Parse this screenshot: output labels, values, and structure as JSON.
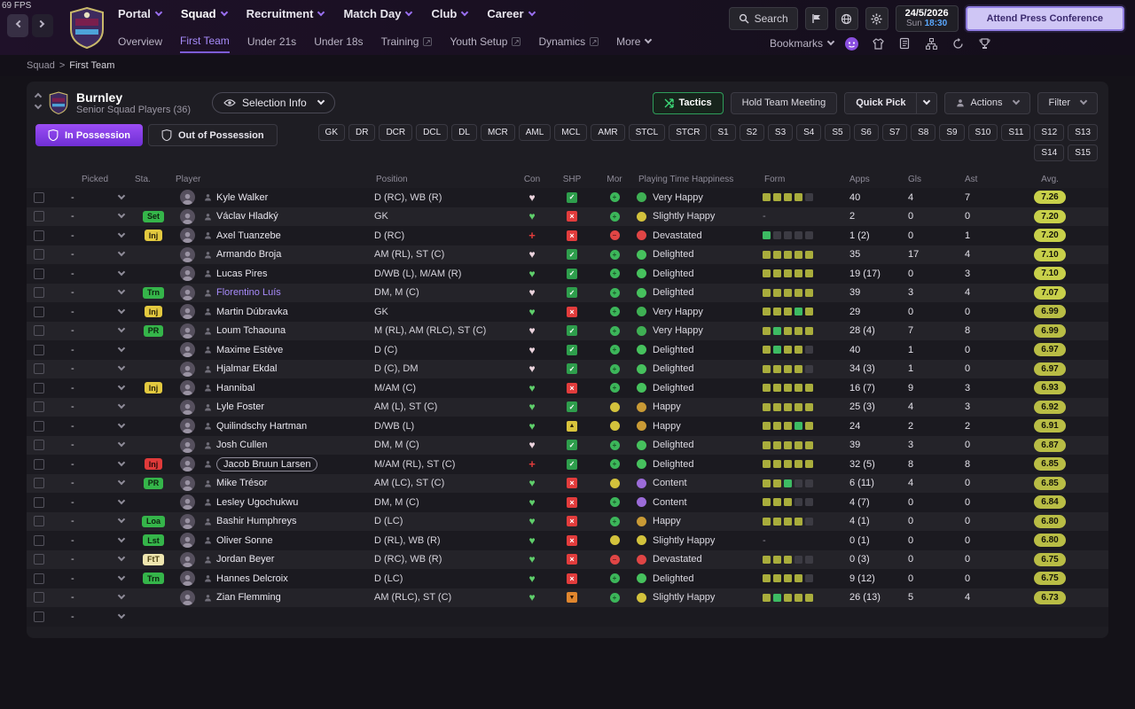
{
  "fps": "69 FPS",
  "search_label": "Search",
  "press_button": "Attend Press Conference",
  "datebox": {
    "date": "24/5/2026",
    "day": "Sun",
    "time": "18:30"
  },
  "topnav": {
    "items": [
      {
        "label": "Portal"
      },
      {
        "label": "Squad",
        "active": true
      },
      {
        "label": "Recruitment"
      },
      {
        "label": "Match Day"
      },
      {
        "label": "Club"
      },
      {
        "label": "Career"
      }
    ]
  },
  "subnav": {
    "bookmarks": "Bookmarks",
    "items": [
      {
        "label": "Overview"
      },
      {
        "label": "First Team",
        "active": true
      },
      {
        "label": "Under 21s"
      },
      {
        "label": "Under 18s"
      },
      {
        "label": "Training",
        "external": true
      },
      {
        "label": "Youth Setup",
        "external": true
      },
      {
        "label": "Dynamics",
        "external": true
      },
      {
        "label": "More",
        "caret": true
      }
    ]
  },
  "breadcrumb": {
    "section": "Squad",
    "sep": ">",
    "page": "First Team"
  },
  "header": {
    "club": "Burnley",
    "subtitle": "Senior Squad Players (36)",
    "selection_info": "Selection Info",
    "tactics": "Tactics",
    "hold_meeting": "Hold Team Meeting",
    "quick_pick": "Quick Pick",
    "actions": "Actions",
    "filter": "Filter"
  },
  "toggles": {
    "in": "In Possession",
    "out": "Out of Possession"
  },
  "chips": [
    "GK",
    "DR",
    "DCR",
    "DCL",
    "DL",
    "MCR",
    "AML",
    "MCL",
    "AMR",
    "STCL",
    "STCR",
    "S1",
    "S2",
    "S3",
    "S4",
    "S5",
    "S6",
    "S7",
    "S8",
    "S9",
    "S10",
    "S11",
    "S12",
    "S13",
    "S14",
    "S15"
  ],
  "columns": [
    "Picked",
    "Sta.",
    "Player",
    "Position",
    "Con",
    "SHP",
    "Mor",
    "Playing Time Happiness",
    "Form",
    "Apps",
    "Gls",
    "Ast",
    "Avg."
  ],
  "icons": {
    "search": "magnifier",
    "settings": "gear",
    "flag": "flag",
    "globe": "globe",
    "eye": "eye",
    "shield": "shield",
    "tactics": "cross-arrows",
    "assistant": "chat-face",
    "shirt": "kit",
    "notes": "notebook",
    "hierarchy": "org-chart",
    "refresh": "cycle-arrows",
    "trophy": "cup"
  },
  "colors": {
    "accent": "#7c5cd6",
    "avg_hi": "#c8d04a",
    "avg": "#b9bd45",
    "time": "#5aa8ff"
  },
  "rows": [
    {
      "picked": "-",
      "st": null,
      "n": "Kyle Walker",
      "pos": "D (RC), WB (R)",
      "con": "pale",
      "shp": "check",
      "mor": "green",
      "hapl": "Very Happy",
      "hapt": "vhappy",
      "form": [
        "y",
        "y",
        "y",
        "y",
        "e"
      ],
      "apps": "40",
      "gls": "4",
      "ast": "7",
      "avg": "7.26",
      "hi": true
    },
    {
      "picked": "-",
      "st": {
        "t": "Set",
        "c": "green"
      },
      "n": "Václav Hladký",
      "pos": "GK",
      "con": "green",
      "shp": "cross",
      "mor": "green",
      "hapl": "Slightly Happy",
      "hapt": "slight",
      "form": null,
      "apps": "2",
      "gls": "0",
      "ast": "0",
      "avg": "7.20",
      "hi": true
    },
    {
      "picked": "-",
      "st": {
        "t": "Inj",
        "c": "yellow"
      },
      "n": "Axel Tuanzebe",
      "pos": "D (RC)",
      "con": "inj",
      "shp": "cross",
      "mor": "red",
      "hapl": "Devastated",
      "hapt": "dev",
      "form": [
        "g",
        "e",
        "e",
        "e",
        "e"
      ],
      "apps": "1 (2)",
      "gls": "0",
      "ast": "1",
      "avg": "7.20",
      "hi": true
    },
    {
      "picked": "-",
      "st": null,
      "n": "Armando Broja",
      "pos": "AM (RL), ST (C)",
      "con": "pale",
      "shp": "check",
      "mor": "green",
      "hapl": "Delighted",
      "hapt": "del",
      "form": [
        "y",
        "y",
        "y",
        "y",
        "y"
      ],
      "apps": "35",
      "gls": "17",
      "ast": "4",
      "avg": "7.10",
      "hi": true
    },
    {
      "picked": "-",
      "st": null,
      "n": "Lucas Pires",
      "pos": "D/WB (L), M/AM (R)",
      "con": "green",
      "shp": "check",
      "mor": "green",
      "hapl": "Delighted",
      "hapt": "del",
      "form": [
        "y",
        "y",
        "y",
        "y",
        "y"
      ],
      "apps": "19 (17)",
      "gls": "0",
      "ast": "3",
      "avg": "7.10",
      "hi": true
    },
    {
      "picked": "-",
      "st": {
        "t": "Trn",
        "c": "green"
      },
      "n": "Florentino Luís",
      "sty": "link",
      "pos": "DM, M (C)",
      "con": "pale",
      "shp": "check",
      "mor": "green",
      "hapl": "Delighted",
      "hapt": "del",
      "form": [
        "y",
        "y",
        "y",
        "y",
        "y"
      ],
      "apps": "39",
      "gls": "3",
      "ast": "4",
      "avg": "7.07",
      "hi": true
    },
    {
      "picked": "-",
      "st": {
        "t": "Inj",
        "c": "yellow"
      },
      "n": "Martin Dúbravka",
      "pos": "GK",
      "con": "green",
      "shp": "cross",
      "mor": "green",
      "hapl": "Very Happy",
      "hapt": "vhappy",
      "form": [
        "y",
        "y",
        "y",
        "g",
        "y"
      ],
      "apps": "29",
      "gls": "0",
      "ast": "0",
      "avg": "6.99",
      "hi": false
    },
    {
      "picked": "-",
      "st": {
        "t": "PR",
        "c": "green"
      },
      "n": "Loum Tchaouna",
      "pos": "M (RL), AM (RLC), ST (C)",
      "con": "pale",
      "shp": "check",
      "mor": "green",
      "hapl": "Very Happy",
      "hapt": "vhappy",
      "form": [
        "y",
        "g",
        "y",
        "y",
        "y"
      ],
      "apps": "28 (4)",
      "gls": "7",
      "ast": "8",
      "avg": "6.99",
      "hi": false
    },
    {
      "picked": "-",
      "st": null,
      "n": "Maxime Estève",
      "pos": "D (C)",
      "con": "pale",
      "shp": "check",
      "mor": "green",
      "hapl": "Delighted",
      "hapt": "del",
      "form": [
        "y",
        "g",
        "y",
        "y",
        "e"
      ],
      "apps": "40",
      "gls": "1",
      "ast": "0",
      "avg": "6.97",
      "hi": false
    },
    {
      "picked": "-",
      "st": null,
      "n": "Hjalmar Ekdal",
      "pos": "D (C), DM",
      "con": "pale",
      "shp": "check",
      "mor": "green",
      "hapl": "Delighted",
      "hapt": "del",
      "form": [
        "y",
        "y",
        "y",
        "y",
        "e"
      ],
      "apps": "34 (3)",
      "gls": "1",
      "ast": "0",
      "avg": "6.97",
      "hi": false
    },
    {
      "picked": "-",
      "st": {
        "t": "Inj",
        "c": "yellow"
      },
      "n": "Hannibal",
      "pos": "M/AM (C)",
      "con": "green",
      "shp": "cross",
      "mor": "green",
      "hapl": "Delighted",
      "hapt": "del",
      "form": [
        "y",
        "y",
        "y",
        "y",
        "y"
      ],
      "apps": "16 (7)",
      "gls": "9",
      "ast": "3",
      "avg": "6.93",
      "hi": false
    },
    {
      "picked": "-",
      "st": null,
      "n": "Lyle Foster",
      "pos": "AM (L), ST (C)",
      "con": "green",
      "shp": "check",
      "mor": "yellow",
      "hapl": "Happy",
      "hapt": "happy",
      "form": [
        "y",
        "y",
        "y",
        "y",
        "y"
      ],
      "apps": "25 (3)",
      "gls": "4",
      "ast": "3",
      "avg": "6.92",
      "hi": false
    },
    {
      "picked": "-",
      "st": null,
      "n": "Quilindschy Hartman",
      "pos": "D/WB (L)",
      "con": "green",
      "shp": "up",
      "mor": "yellow",
      "hapl": "Happy",
      "hapt": "happy",
      "form": [
        "y",
        "y",
        "y",
        "g",
        "y"
      ],
      "apps": "24",
      "gls": "2",
      "ast": "2",
      "avg": "6.91",
      "hi": false
    },
    {
      "picked": "-",
      "st": null,
      "n": "Josh Cullen",
      "pos": "DM, M (C)",
      "con": "pale",
      "shp": "check",
      "mor": "green",
      "hapl": "Delighted",
      "hapt": "del",
      "form": [
        "y",
        "y",
        "y",
        "y",
        "y"
      ],
      "apps": "39",
      "gls": "3",
      "ast": "0",
      "avg": "6.87",
      "hi": false
    },
    {
      "picked": "-",
      "st": {
        "t": "Inj",
        "c": "red"
      },
      "n": "Jacob Bruun Larsen",
      "sty": "boxed",
      "pos": "M/AM (RL), ST (C)",
      "con": "inj",
      "shp": "check",
      "mor": "green",
      "hapl": "Delighted",
      "hapt": "del",
      "form": [
        "y",
        "y",
        "y",
        "y",
        "y"
      ],
      "apps": "32 (5)",
      "gls": "8",
      "ast": "8",
      "avg": "6.85",
      "hi": false
    },
    {
      "picked": "-",
      "st": {
        "t": "PR",
        "c": "green"
      },
      "n": "Mike Trésor",
      "pos": "AM (LC), ST (C)",
      "con": "green",
      "shp": "cross",
      "mor": "yellow",
      "hapl": "Content",
      "hapt": "content",
      "form": [
        "y",
        "y",
        "g",
        "e",
        "e"
      ],
      "apps": "6 (11)",
      "gls": "4",
      "ast": "0",
      "avg": "6.85",
      "hi": false
    },
    {
      "picked": "-",
      "st": null,
      "n": "Lesley Ugochukwu",
      "pos": "DM, M (C)",
      "con": "green",
      "shp": "cross",
      "mor": "green",
      "hapl": "Content",
      "hapt": "content",
      "form": [
        "y",
        "y",
        "y",
        "e",
        "e"
      ],
      "apps": "4 (7)",
      "gls": "0",
      "ast": "0",
      "avg": "6.84",
      "hi": false
    },
    {
      "picked": "-",
      "st": {
        "t": "Loa",
        "c": "green"
      },
      "n": "Bashir Humphreys",
      "pos": "D (LC)",
      "con": "green",
      "shp": "cross",
      "mor": "green",
      "hapl": "Happy",
      "hapt": "happy",
      "form": [
        "y",
        "y",
        "y",
        "y",
        "e"
      ],
      "apps": "4 (1)",
      "gls": "0",
      "ast": "0",
      "avg": "6.80",
      "hi": false
    },
    {
      "picked": "-",
      "st": {
        "t": "Lst",
        "c": "green"
      },
      "n": "Oliver Sonne",
      "pos": "D (RL), WB (R)",
      "con": "green",
      "shp": "cross",
      "mor": "yellow",
      "hapl": "Slightly Happy",
      "hapt": "slight",
      "form": null,
      "apps": "0 (1)",
      "gls": "0",
      "ast": "0",
      "avg": "6.80",
      "hi": false
    },
    {
      "picked": "-",
      "st": {
        "t": "FtT",
        "c": "cream"
      },
      "n": "Jordan Beyer",
      "pos": "D (RC), WB (R)",
      "con": "green",
      "shp": "cross",
      "mor": "red",
      "hapl": "Devastated",
      "hapt": "dev",
      "form": [
        "y",
        "y",
        "y",
        "e",
        "e"
      ],
      "apps": "0 (3)",
      "gls": "0",
      "ast": "0",
      "avg": "6.75",
      "hi": false
    },
    {
      "picked": "-",
      "st": {
        "t": "Trn",
        "c": "green"
      },
      "n": "Hannes Delcroix",
      "pos": "D (LC)",
      "con": "green",
      "shp": "cross",
      "mor": "green",
      "hapl": "Delighted",
      "hapt": "del",
      "form": [
        "y",
        "y",
        "y",
        "y",
        "e"
      ],
      "apps": "9 (12)",
      "gls": "0",
      "ast": "0",
      "avg": "6.75",
      "hi": false
    },
    {
      "picked": "-",
      "st": null,
      "n": "Zian Flemming",
      "pos": "AM (RLC), ST (C)",
      "con": "green",
      "shp": "down",
      "mor": "green",
      "hapl": "Slightly Happy",
      "hapt": "slight",
      "form": [
        "y",
        "g",
        "y",
        "y",
        "y"
      ],
      "apps": "26 (13)",
      "gls": "5",
      "ast": "4",
      "avg": "6.73",
      "hi": false
    },
    {
      "picked": "-",
      "partial": true
    }
  ]
}
